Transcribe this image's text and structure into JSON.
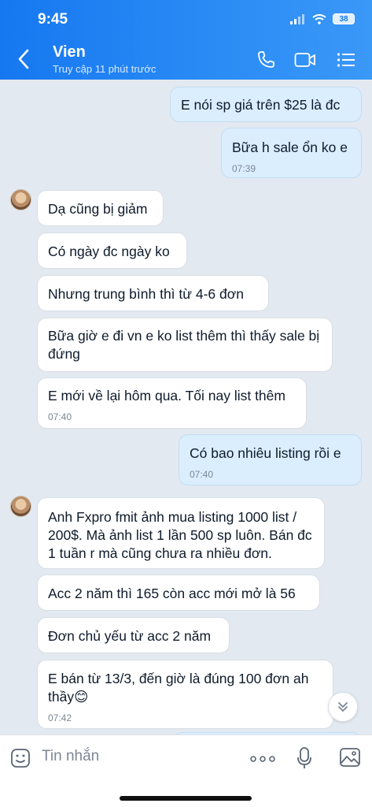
{
  "status_bar": {
    "time": "9:45",
    "battery": "38"
  },
  "header": {
    "contact_name": "Vien",
    "last_seen": "Truy cập 11 phút trước"
  },
  "messages": [
    {
      "dir": "out",
      "text": "E nói sp giá trên $25 là đc",
      "time": ""
    },
    {
      "dir": "out",
      "text": "Bữa h sale ổn ko e",
      "time": "07:39"
    },
    {
      "dir": "in",
      "text": "Dạ cũng bị giảm",
      "time": ""
    },
    {
      "dir": "in",
      "text": "Có ngày đc ngày ko",
      "time": ""
    },
    {
      "dir": "in",
      "text": "Nhưng trung bình thì từ 4-6 đơn",
      "time": ""
    },
    {
      "dir": "in",
      "text": "Bữa giờ e đi vn e ko list thêm thì thấy sale bị đứng",
      "time": ""
    },
    {
      "dir": "in",
      "text": "E mới về lại hôm qua. Tối nay list thêm",
      "time": "07:40"
    },
    {
      "dir": "out",
      "text": "Có bao nhiêu listing rồi e",
      "time": "07:40"
    },
    {
      "dir": "in",
      "text": "Anh Fxpro fmit ảnh mua listing 1000 list / 200$. Mà ảnh list 1 lần 500 sp luôn. Bán đc 1 tuần r mà cũng chưa ra nhiều đơn.",
      "time": ""
    },
    {
      "dir": "in",
      "text": "Acc 2 năm thì 165 còn acc mới mở là 56",
      "time": ""
    },
    {
      "dir": "in",
      "text": "Đơn chủ yếu từ acc 2 năm",
      "time": ""
    },
    {
      "dir": "in",
      "text": "E bán từ 13/3, đến giờ là đúng 100 đơn ah thầy😊",
      "time": "07:42"
    }
  ],
  "composer": {
    "placeholder": "Tin nhắn"
  },
  "icons": {
    "back": "chevron-left-icon",
    "call": "phone-icon",
    "video": "video-camera-icon",
    "menu": "list-menu-icon",
    "sticker": "sticker-icon",
    "more": "more-dots-icon",
    "mic": "microphone-icon",
    "image": "image-icon",
    "scroll": "chevron-double-down-icon"
  }
}
